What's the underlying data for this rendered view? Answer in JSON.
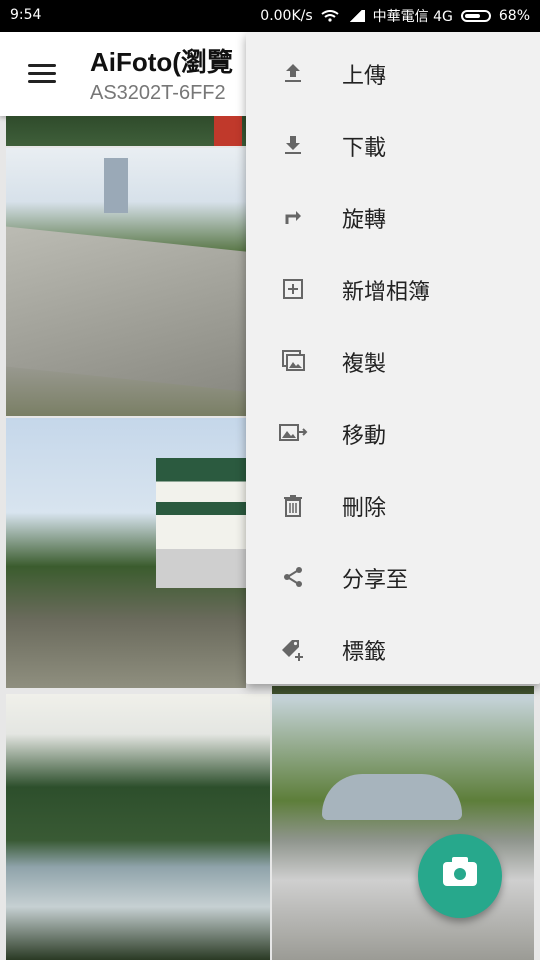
{
  "status": {
    "time": "9:54",
    "speed": "0.00K/s",
    "carrier": "中華電信 4G",
    "battery": "68%"
  },
  "appbar": {
    "title": "AiFoto(瀏覽",
    "subtitle": "AS3202T-6FF2"
  },
  "menu": {
    "items": [
      {
        "label": "上傳",
        "icon": "upload-icon",
        "glyph": "⤒"
      },
      {
        "label": "下載",
        "icon": "download-icon",
        "glyph": "⤓"
      },
      {
        "label": "旋轉",
        "icon": "rotate-icon",
        "glyph": "↱"
      },
      {
        "label": "新增相簿",
        "icon": "add-album-icon",
        "glyph": "⊞"
      },
      {
        "label": "複製",
        "icon": "copy-icon",
        "glyph": "▣"
      },
      {
        "label": "移動",
        "icon": "move-icon",
        "glyph": "⇥"
      },
      {
        "label": "刪除",
        "icon": "delete-icon",
        "glyph": "🗑"
      },
      {
        "label": "分享至",
        "icon": "share-icon",
        "glyph": "⋖"
      },
      {
        "label": "標籤",
        "icon": "tag-icon",
        "glyph": "🏷"
      }
    ]
  },
  "fab": {
    "icon": "camera-icon"
  },
  "colors": {
    "accent": "#27a88c"
  }
}
